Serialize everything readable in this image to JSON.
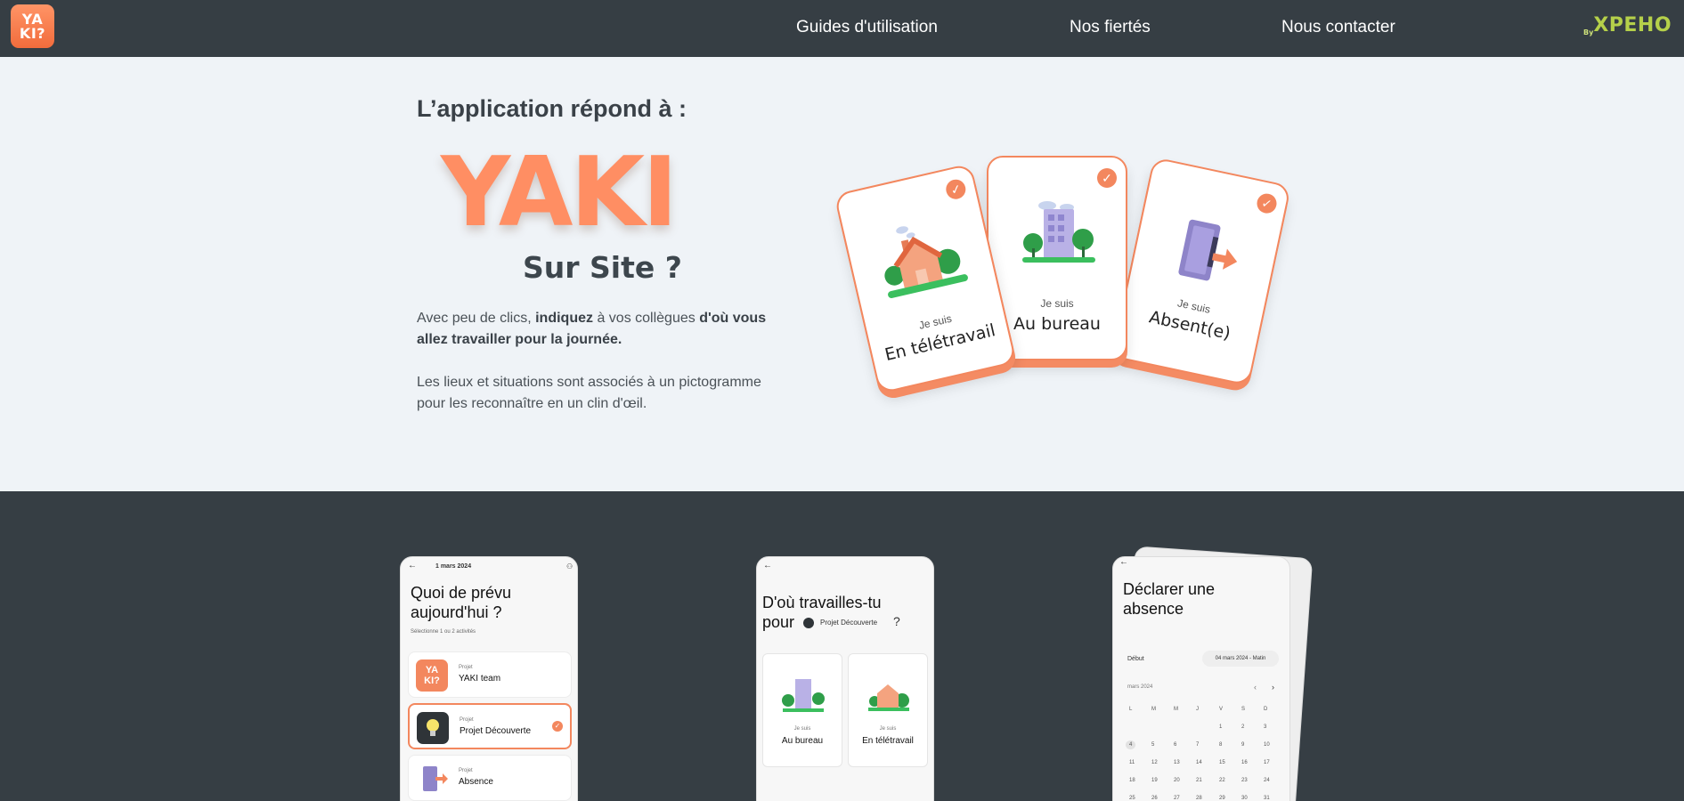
{
  "header": {
    "logo_line1": "YA",
    "logo_line2": "KI?",
    "nav": [
      "Guides d'utilisation",
      "Nos fiertés",
      "Nous contacter"
    ],
    "brand_by": "By",
    "brand_name": "XPEHO"
  },
  "intro": {
    "title": "L’application répond à :",
    "yaki": "YAKI",
    "sursite": "Sur Site ?",
    "p1_a": "Avec peu de clics, ",
    "p1_b": "indiquez",
    "p1_c": " à vos collègues ",
    "p1_d": "d'où vous allez travailler pour la journée.",
    "p2": "Les lieux et situations sont associés à un pictogramme pour les reconnaître en un clin d'œil."
  },
  "cards": [
    {
      "je": "Je suis",
      "label": "En télétravail"
    },
    {
      "je": "Je suis",
      "label": "Au bureau"
    },
    {
      "je": "Je suis",
      "label": "Absent(e)"
    }
  ],
  "phone1": {
    "date": "1 mars 2024",
    "title_l1": "Quoi de prévu",
    "title_l2": "aujourd'hui ?",
    "subtitle": "Sélectionne 1 ou 2 activités",
    "items": [
      {
        "k": "Projet",
        "v": "YAKI team"
      },
      {
        "k": "Projet",
        "v": "Projet Découverte"
      },
      {
        "k": "Projet",
        "v": "Absence"
      }
    ]
  },
  "phone2": {
    "title_l1": "D'où travailles-tu",
    "title_l2": "pour",
    "project": "Projet Découverte",
    "q": "?",
    "options": [
      {
        "je": "Je suis",
        "label": "Au bureau"
      },
      {
        "je": "Je suis",
        "label": "En télétravail"
      }
    ]
  },
  "phone3": {
    "title_l1": "Déclarer une",
    "title_l2": "absence",
    "start": "Début",
    "start_value": "04 mars 2024 - Matin",
    "month": "mars 2024",
    "weekdays": [
      "L",
      "M",
      "M",
      "J",
      "V",
      "S",
      "D"
    ],
    "days": [
      "1",
      "2",
      "3",
      "4",
      "5",
      "6",
      "7",
      "8",
      "9",
      "10",
      "11",
      "12",
      "13",
      "14",
      "15",
      "16",
      "17",
      "18",
      "19",
      "20",
      "21",
      "22",
      "23",
      "24",
      "25",
      "26",
      "27",
      "28",
      "29",
      "30",
      "31"
    ]
  },
  "colors": {
    "accent": "#f3875e",
    "dark": "#363e44",
    "light_bg": "#eff3f7",
    "brand": "#b5d04a"
  }
}
